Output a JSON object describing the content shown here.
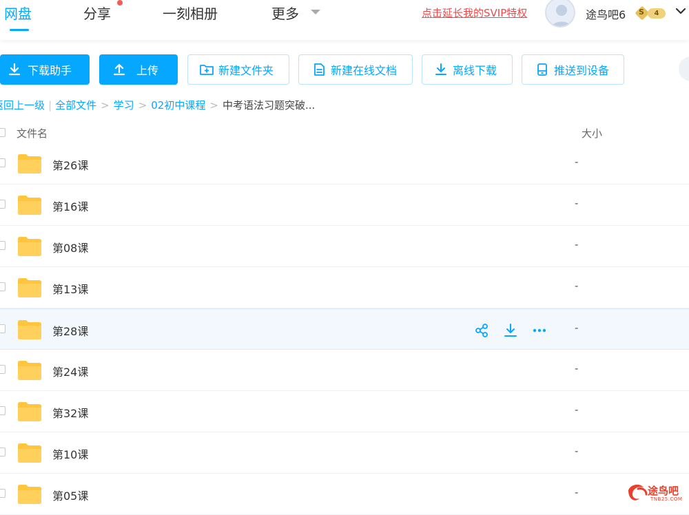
{
  "nav": {
    "tabs": [
      {
        "label": "网盘",
        "active": true
      },
      {
        "label": "分享",
        "has_dot": true
      },
      {
        "label": "一刻相册"
      },
      {
        "label": "更多"
      }
    ],
    "svip_link": "点击延长我的SVIP特权",
    "username": "途鸟吧6",
    "vip_level": "4",
    "vip_symbol": "S"
  },
  "toolbar": {
    "download_helper": "下载助手",
    "upload": "上传",
    "new_folder": "新建文件夹",
    "new_online_doc": "新建在线文档",
    "offline_download": "离线下载",
    "push_to_device": "推送到设备"
  },
  "breadcrumb": {
    "back": "返回上一级",
    "items": [
      "全部文件",
      "学习",
      "02初中课程"
    ],
    "current": "中考语法习题突破..."
  },
  "table": {
    "headers": {
      "name": "文件名",
      "size": "大小"
    },
    "rows": [
      {
        "name": "第26课",
        "size": "-"
      },
      {
        "name": "第16课",
        "size": "-"
      },
      {
        "name": "第08课",
        "size": "-"
      },
      {
        "name": "第13课",
        "size": "-"
      },
      {
        "name": "第28课",
        "size": "-",
        "hover": true
      },
      {
        "name": "第24课",
        "size": "-"
      },
      {
        "name": "第32课",
        "size": "-"
      },
      {
        "name": "第10课",
        "size": "-"
      },
      {
        "name": "第05课",
        "size": "-"
      }
    ],
    "row_actions": [
      "share-icon",
      "download-icon",
      "more-icon"
    ]
  },
  "watermark": {
    "text": "途鸟吧",
    "sub": "TNB25.COM"
  },
  "colors": {
    "accent": "#06a7ff",
    "folder": "#ffc53d",
    "svip": "#f04a4a",
    "hover_row": "#f2f8fd"
  }
}
